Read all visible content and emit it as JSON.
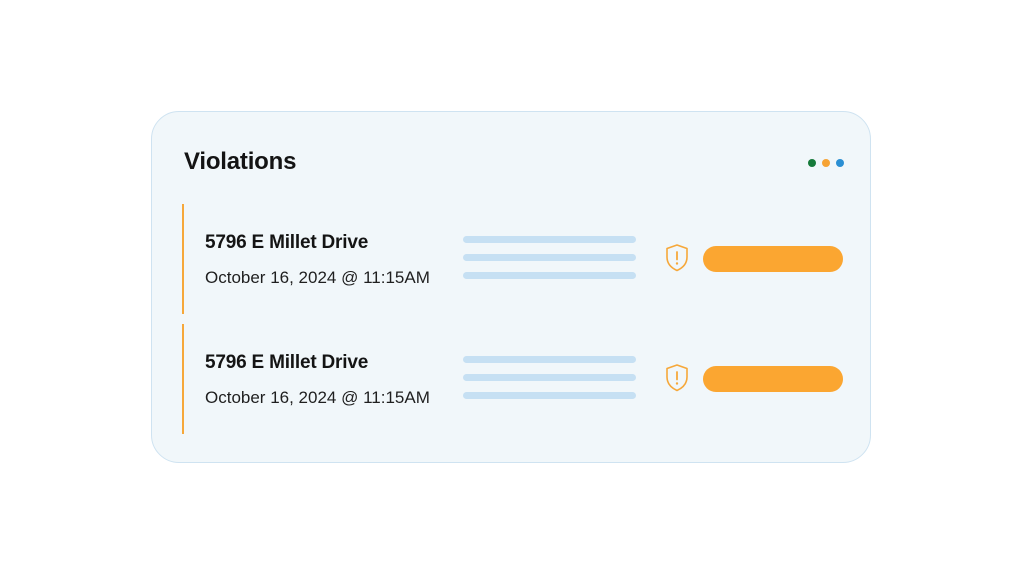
{
  "card": {
    "title": "Violations"
  },
  "window_dots": [
    {
      "color": "#167a3a"
    },
    {
      "color": "#f6a334"
    },
    {
      "color": "#2b8fd3"
    }
  ],
  "colors": {
    "accent": "#f6a83a",
    "placeholder": "#c6e0f3",
    "status_pill": "#fba631",
    "card_background": "#f1f7fa"
  },
  "violations": [
    {
      "address": "5796 E Millet Drive",
      "datetime": "October 16, 2024 @ 11:15AM",
      "icon": "shield-alert-icon"
    },
    {
      "address": "5796 E Millet Drive",
      "datetime": "October 16, 2024 @ 11:15AM",
      "icon": "shield-alert-icon"
    }
  ]
}
